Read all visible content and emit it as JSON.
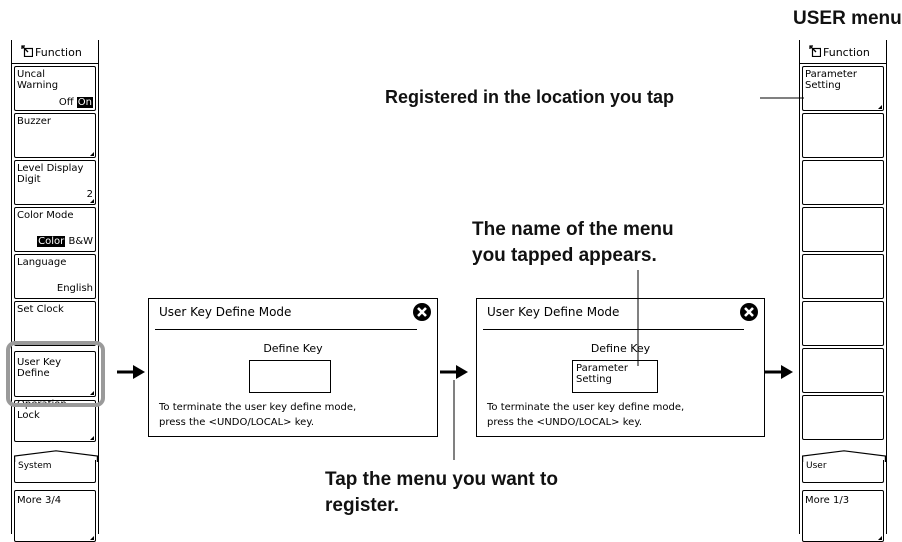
{
  "left_menu": {
    "header": "Function",
    "items": [
      {
        "label": "Uncal\nWarning",
        "value_off": "Off",
        "value_on": "On"
      },
      {
        "label": "Buzzer"
      },
      {
        "label": "Level Display\nDigit",
        "value": "2"
      },
      {
        "label": "Color Mode",
        "value_selected": "Color",
        "value_other": "B&W"
      },
      {
        "label": "Language",
        "value": "English"
      },
      {
        "label": "Set Clock"
      },
      {
        "label": "User Key\nDefine"
      },
      {
        "label": "Operation\nLock"
      }
    ],
    "tab": "System",
    "more": "More 3/4"
  },
  "dialog1": {
    "title": "User Key Define Mode",
    "define_key_label": "Define Key",
    "key_value": "",
    "note_line1": "To terminate the user key define mode,",
    "note_line2": "press the <UNDO/LOCAL> key."
  },
  "dialog2": {
    "title": "User Key Define Mode",
    "define_key_label": "Define Key",
    "key_value": "Parameter\nSetting",
    "note_line1": "To terminate the user key define mode,",
    "note_line2": "press the <UNDO/LOCAL> key."
  },
  "right_menu": {
    "caption": "USER menu",
    "header": "Function",
    "items": [
      {
        "label": "Parameter\nSetting"
      }
    ],
    "tab": "User",
    "more": "More 1/3"
  },
  "callouts": {
    "registered": "Registered in the location you tap",
    "name_line1": "The name of the menu",
    "name_line2": "you tapped appears.",
    "tap_line1": "Tap the menu you want to",
    "tap_line2": "register."
  },
  "icons": {
    "close": "close-circle-icon",
    "function": "function-menu-icon",
    "arrow": "right-arrow-icon"
  }
}
